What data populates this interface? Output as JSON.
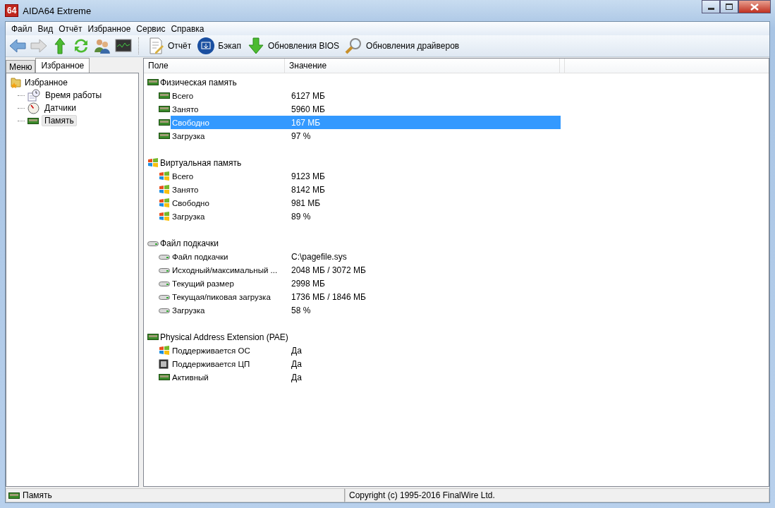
{
  "window": {
    "title": "AIDA64 Extreme",
    "logo": "64"
  },
  "menu": [
    "Файл",
    "Вид",
    "Отчёт",
    "Избранное",
    "Сервис",
    "Справка"
  ],
  "toolbar": [
    {
      "kind": "back"
    },
    {
      "kind": "forward"
    },
    {
      "kind": "up"
    },
    {
      "kind": "refresh"
    },
    {
      "kind": "users"
    },
    {
      "kind": "monitor"
    },
    {
      "kind": "report",
      "label": "Отчёт"
    },
    {
      "kind": "backup",
      "label": "Бэкап"
    },
    {
      "kind": "download",
      "label": "Обновления BIOS"
    },
    {
      "kind": "search",
      "label": "Обновления драйверов"
    }
  ],
  "tabs": [
    {
      "label": "Меню",
      "selected": false
    },
    {
      "label": "Избранное",
      "selected": true
    }
  ],
  "tree": {
    "label": "Избранное",
    "kind": "folder",
    "children": [
      {
        "label": "Время работы",
        "kind": "clock",
        "selected": false
      },
      {
        "label": "Датчики",
        "kind": "gauge",
        "selected": false
      },
      {
        "label": "Память",
        "kind": "ram",
        "selected": true
      }
    ]
  },
  "table": {
    "columns": [
      "Поле",
      "Значение"
    ],
    "groups": [
      {
        "title": "Физическая память",
        "kind": "ram",
        "rows": [
          {
            "field": "Всего",
            "value": "6127 МБ",
            "kind": "ram",
            "selected": false
          },
          {
            "field": "Занято",
            "value": "5960 МБ",
            "kind": "ram",
            "selected": false
          },
          {
            "field": "Свободно",
            "value": "167 МБ",
            "kind": "ram",
            "selected": true
          },
          {
            "field": "Загрузка",
            "value": "97 %",
            "kind": "ram",
            "selected": false
          }
        ]
      },
      {
        "title": "Виртуальная память",
        "kind": "windows",
        "rows": [
          {
            "field": "Всего",
            "value": "9123 МБ",
            "kind": "windows",
            "selected": false
          },
          {
            "field": "Занято",
            "value": "8142 МБ",
            "kind": "windows",
            "selected": false
          },
          {
            "field": "Свободно",
            "value": "981 МБ",
            "kind": "windows",
            "selected": false
          },
          {
            "field": "Загрузка",
            "value": "89 %",
            "kind": "windows",
            "selected": false
          }
        ]
      },
      {
        "title": "Файл подкачки",
        "kind": "disk",
        "rows": [
          {
            "field": "Файл подкачки",
            "value": "C:\\pagefile.sys",
            "kind": "disk",
            "selected": false
          },
          {
            "field": "Исходный/максимальный ...",
            "value": "2048 МБ / 3072 МБ",
            "kind": "disk",
            "selected": false
          },
          {
            "field": "Текущий размер",
            "value": "2998 МБ",
            "kind": "disk",
            "selected": false
          },
          {
            "field": "Текущая/пиковая загрузка",
            "value": "1736 МБ / 1846 МБ",
            "kind": "disk",
            "selected": false
          },
          {
            "field": "Загрузка",
            "value": "58 %",
            "kind": "disk",
            "selected": false
          }
        ]
      },
      {
        "title": "Physical Address Extension (PAE)",
        "kind": "ram",
        "rows": [
          {
            "field": "Поддерживается ОС",
            "value": "Да",
            "kind": "windows",
            "selected": false
          },
          {
            "field": "Поддерживается ЦП",
            "value": "Да",
            "kind": "cpu",
            "selected": false
          },
          {
            "field": "Активный",
            "value": "Да",
            "kind": "ram",
            "selected": false
          }
        ]
      }
    ]
  },
  "status_bar": {
    "kind": "ram",
    "left": "Память",
    "right": "Copyright (c) 1995-2016 FinalWire Ltd."
  }
}
